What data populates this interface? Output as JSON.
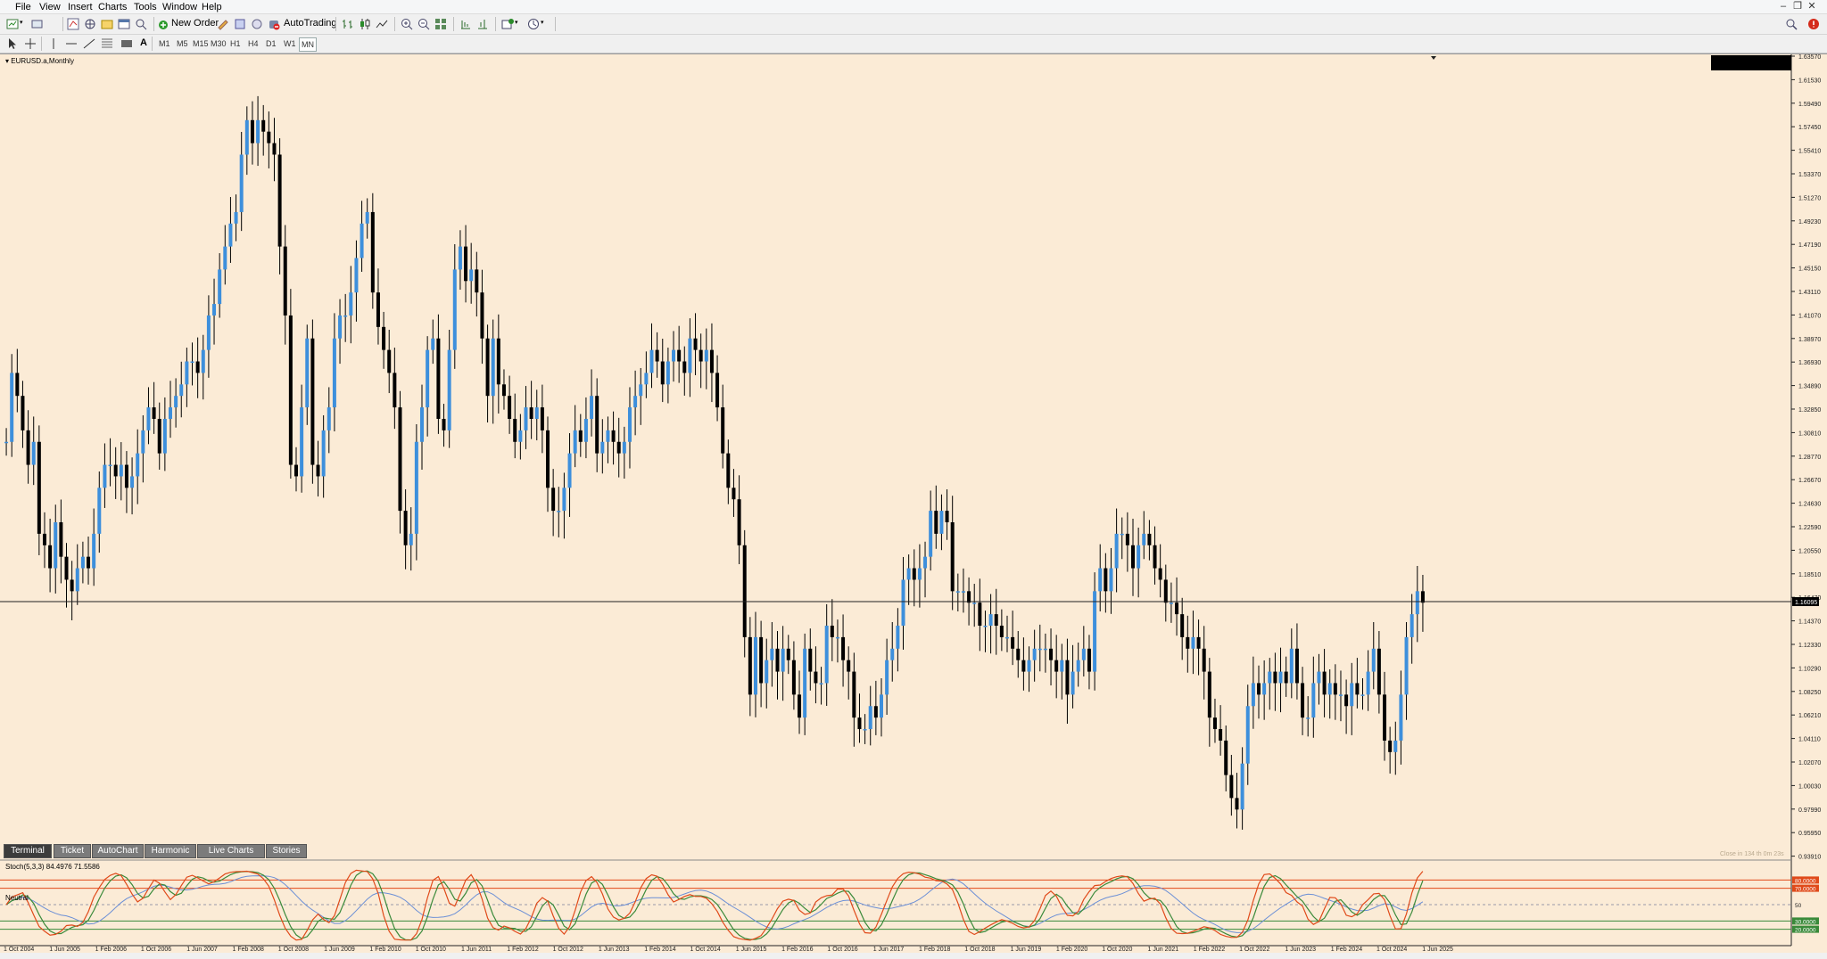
{
  "menu": [
    "File",
    "View",
    "Insert",
    "Charts",
    "Tools",
    "Window",
    "Help"
  ],
  "toolbar": {
    "new_order": "New Order",
    "autotrading": "AutoTrading"
  },
  "timeframes": [
    "M1",
    "M5",
    "M15",
    "M30",
    "H1",
    "H4",
    "D1",
    "W1",
    "MN"
  ],
  "active_timeframe": "MN",
  "chart": {
    "symbol": "EURUSD.a,Monthly",
    "current_price": "1.16095",
    "timer": "Close in 134 th 0m 23s",
    "price_labels": [
      "1.63570",
      "1.61530",
      "1.59490",
      "1.57450",
      "1.55410",
      "1.53370",
      "1.51270",
      "1.49230",
      "1.47190",
      "1.45150",
      "1.43110",
      "1.41070",
      "1.38970",
      "1.36930",
      "1.34890",
      "1.32850",
      "1.30810",
      "1.28770",
      "1.26670",
      "1.24630",
      "1.22590",
      "1.20550",
      "1.18510",
      "1.16470",
      "1.14370",
      "1.12330",
      "1.10290",
      "1.08250",
      "1.06210",
      "1.04110",
      "1.02070",
      "1.00030",
      "0.97990",
      "0.95950",
      "0.93910"
    ],
    "date_labels": [
      "1 Oct 2004",
      "1 Jun 2005",
      "1 Feb 2006",
      "1 Oct 2006",
      "1 Jun 2007",
      "1 Feb 2008",
      "1 Oct 2008",
      "1 Jun 2009",
      "1 Feb 2010",
      "1 Oct 2010",
      "1 Jun 2011",
      "1 Feb 2012",
      "1 Oct 2012",
      "1 Jun 2013",
      "1 Feb 2014",
      "1 Oct 2014",
      "1 Jun 2015",
      "1 Feb 2016",
      "1 Oct 2016",
      "1 Jun 2017",
      "1 Feb 2018",
      "1 Oct 2018",
      "1 Jun 2019",
      "1 Feb 2020",
      "1 Oct 2020",
      "1 Jun 2021",
      "1 Feb 2022",
      "1 Oct 2022",
      "1 Jun 2023",
      "1 Feb 2024",
      "1 Oct 2024",
      "1 Jun 2025"
    ],
    "y_range": [
      0.9391,
      1.6357
    ],
    "bull_color": "#3d8fdc",
    "bear_color": "#000000",
    "background": "#fbebd6",
    "closes": [
      1.3,
      1.36,
      1.34,
      1.31,
      1.28,
      1.3,
      1.22,
      1.21,
      1.19,
      1.23,
      1.2,
      1.18,
      1.17,
      1.19,
      1.2,
      1.19,
      1.22,
      1.26,
      1.28,
      1.28,
      1.27,
      1.28,
      1.26,
      1.27,
      1.29,
      1.31,
      1.33,
      1.32,
      1.29,
      1.32,
      1.33,
      1.34,
      1.35,
      1.37,
      1.37,
      1.36,
      1.38,
      1.41,
      1.42,
      1.45,
      1.47,
      1.49,
      1.5,
      1.55,
      1.58,
      1.56,
      1.58,
      1.57,
      1.56,
      1.55,
      1.47,
      1.41,
      1.28,
      1.27,
      1.33,
      1.39,
      1.28,
      1.27,
      1.31,
      1.33,
      1.39,
      1.41,
      1.41,
      1.43,
      1.46,
      1.49,
      1.5,
      1.43,
      1.4,
      1.38,
      1.36,
      1.33,
      1.24,
      1.21,
      1.22,
      1.3,
      1.33,
      1.38,
      1.39,
      1.32,
      1.31,
      1.38,
      1.45,
      1.47,
      1.44,
      1.45,
      1.43,
      1.39,
      1.34,
      1.39,
      1.35,
      1.34,
      1.32,
      1.3,
      1.31,
      1.33,
      1.32,
      1.33,
      1.31,
      1.26,
      1.24,
      1.24,
      1.26,
      1.29,
      1.31,
      1.3,
      1.32,
      1.34,
      1.29,
      1.3,
      1.31,
      1.3,
      1.29,
      1.3,
      1.33,
      1.34,
      1.35,
      1.36,
      1.38,
      1.37,
      1.35,
      1.37,
      1.38,
      1.37,
      1.36,
      1.39,
      1.38,
      1.37,
      1.38,
      1.36,
      1.33,
      1.29,
      1.26,
      1.25,
      1.21,
      1.13,
      1.08,
      1.13,
      1.09,
      1.11,
      1.12,
      1.1,
      1.12,
      1.11,
      1.08,
      1.06,
      1.12,
      1.1,
      1.09,
      1.09,
      1.14,
      1.13,
      1.13,
      1.11,
      1.1,
      1.06,
      1.05,
      1.05,
      1.07,
      1.06,
      1.08,
      1.11,
      1.12,
      1.14,
      1.18,
      1.19,
      1.18,
      1.19,
      1.2,
      1.24,
      1.22,
      1.24,
      1.23,
      1.17,
      1.17,
      1.17,
      1.16,
      1.16,
      1.14,
      1.14,
      1.15,
      1.14,
      1.13,
      1.13,
      1.12,
      1.11,
      1.1,
      1.11,
      1.12,
      1.12,
      1.12,
      1.11,
      1.1,
      1.11,
      1.08,
      1.1,
      1.11,
      1.12,
      1.1,
      1.17,
      1.19,
      1.17,
      1.19,
      1.22,
      1.22,
      1.21,
      1.19,
      1.21,
      1.22,
      1.21,
      1.19,
      1.18,
      1.16,
      1.16,
      1.15,
      1.13,
      1.12,
      1.13,
      1.12,
      1.1,
      1.06,
      1.05,
      1.04,
      1.01,
      0.99,
      0.98,
      1.02,
      1.07,
      1.09,
      1.08,
      1.09,
      1.1,
      1.09,
      1.1,
      1.09,
      1.12,
      1.09,
      1.06,
      1.06,
      1.09,
      1.1,
      1.08,
      1.09,
      1.08,
      1.08,
      1.07,
      1.09,
      1.08,
      1.08,
      1.1,
      1.12,
      1.08,
      1.04,
      1.03,
      1.04,
      1.08,
      1.13,
      1.15,
      1.17,
      1.16
    ]
  },
  "indicator": {
    "label": "Stoch(5,3,3) 84.4976 71.5586",
    "neutral_label": "Neutral",
    "levels": [
      "80.0000",
      "70.0000",
      "50",
      "30.0000",
      "20.0000"
    ],
    "main_color": "#e04a1a",
    "signal_color": "#3a8a3a",
    "ma_color": "#6b8fd6"
  },
  "tabs": [
    "Terminal",
    "Ticket",
    "AutoChart",
    "Harmonic",
    "Live Charts",
    "Stories"
  ],
  "active_tab": "Terminal"
}
